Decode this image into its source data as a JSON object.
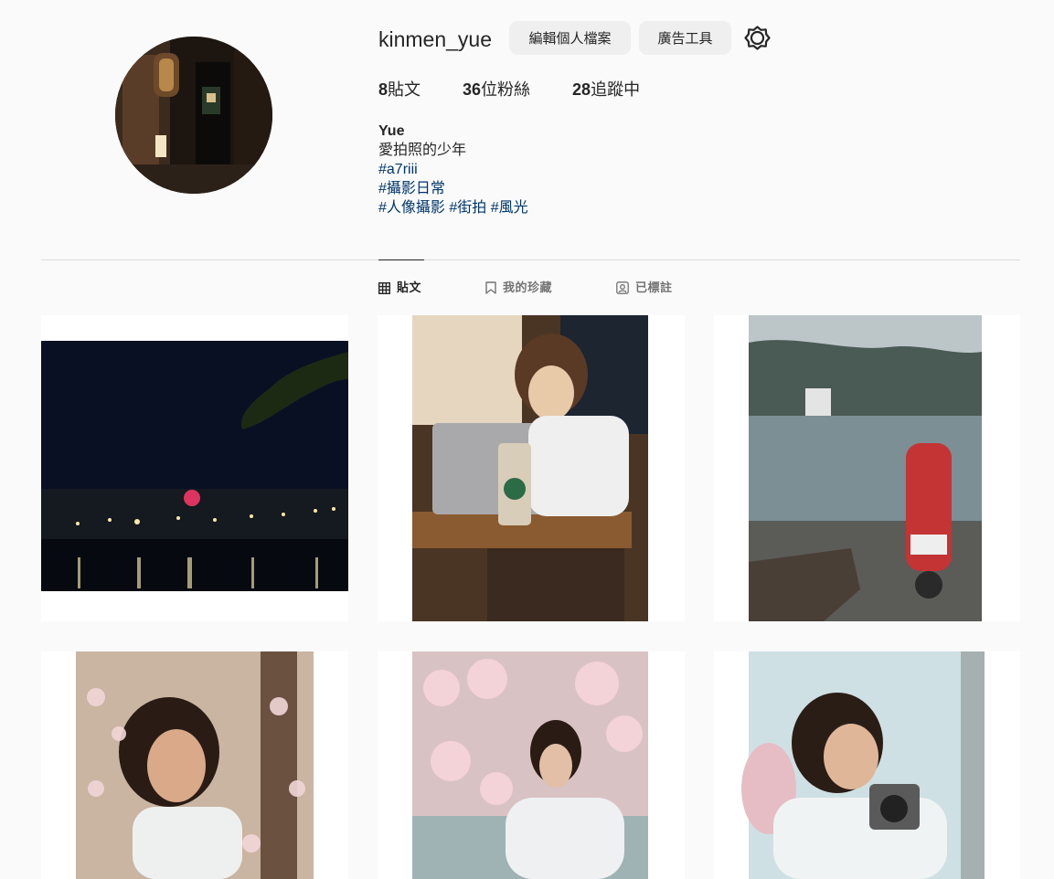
{
  "profile": {
    "username": "kinmen_yue",
    "edit_profile_label": "編輯個人檔案",
    "ad_tools_label": "廣告工具",
    "stats": {
      "posts_count": "8",
      "posts_label": "貼文",
      "followers_count": "36",
      "followers_label": "位粉絲",
      "following_count": "28",
      "following_label": "追蹤中"
    },
    "bio": {
      "name": "Yue",
      "line1": "愛拍照的少年",
      "tag1": "#a7riii",
      "tag2": "#攝影日常",
      "tag3": "#人像攝影",
      "tag4": "#街拍",
      "tag5": "#風光"
    }
  },
  "tabs": {
    "posts": "貼文",
    "saved": "我的珍藏",
    "tagged": "已標註"
  },
  "icons": {
    "settings": "gear-icon",
    "posts_tab": "grid-icon",
    "saved_tab": "bookmark-icon",
    "tagged_tab": "tagged-user-icon"
  },
  "colors": {
    "background": "#fafafa",
    "button_bg": "#efefef",
    "hashtag": "#00376b",
    "divider": "#dbdbdb"
  }
}
